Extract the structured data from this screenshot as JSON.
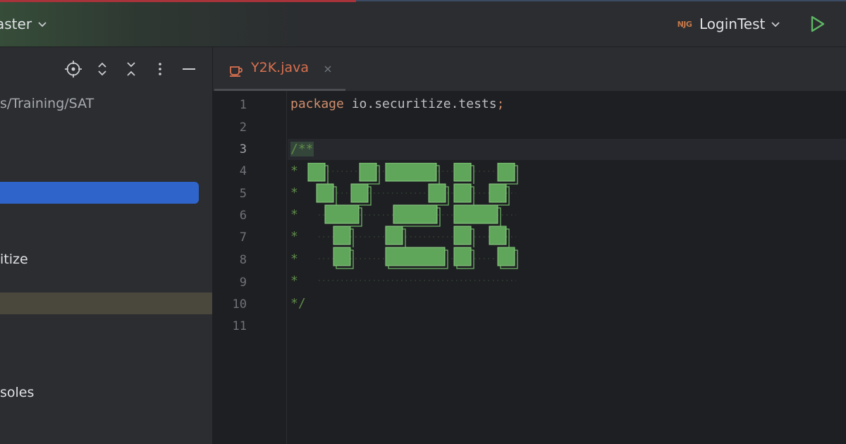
{
  "toolbar": {
    "branch_label": "aster",
    "run_config_icon": "NJG",
    "run_config_label": "LoginTest"
  },
  "project_panel": {
    "rows": [
      {
        "text": "s/Training/SAT"
      },
      {
        "text": "itize"
      },
      {
        "text": "soles"
      }
    ]
  },
  "editor": {
    "tab_label": "Y2K.java",
    "line_numbers": [
      "1",
      "2",
      "3",
      "4",
      "5",
      "6",
      "7",
      "8",
      "9",
      "10",
      "11"
    ],
    "code": {
      "keyword": "package",
      "package_name": " io.securitize.tests",
      "semicolon": ";",
      "comment_open": "/**",
      "comment_star": "*",
      "comment_close": "*/"
    },
    "ascii_art_text": "Y2K"
  },
  "colors": {
    "accent_blue": "#2f65ca",
    "run_green": "#5fb865",
    "art_green": "#5fa55a",
    "keyword_orange": "#cf8e6d"
  }
}
